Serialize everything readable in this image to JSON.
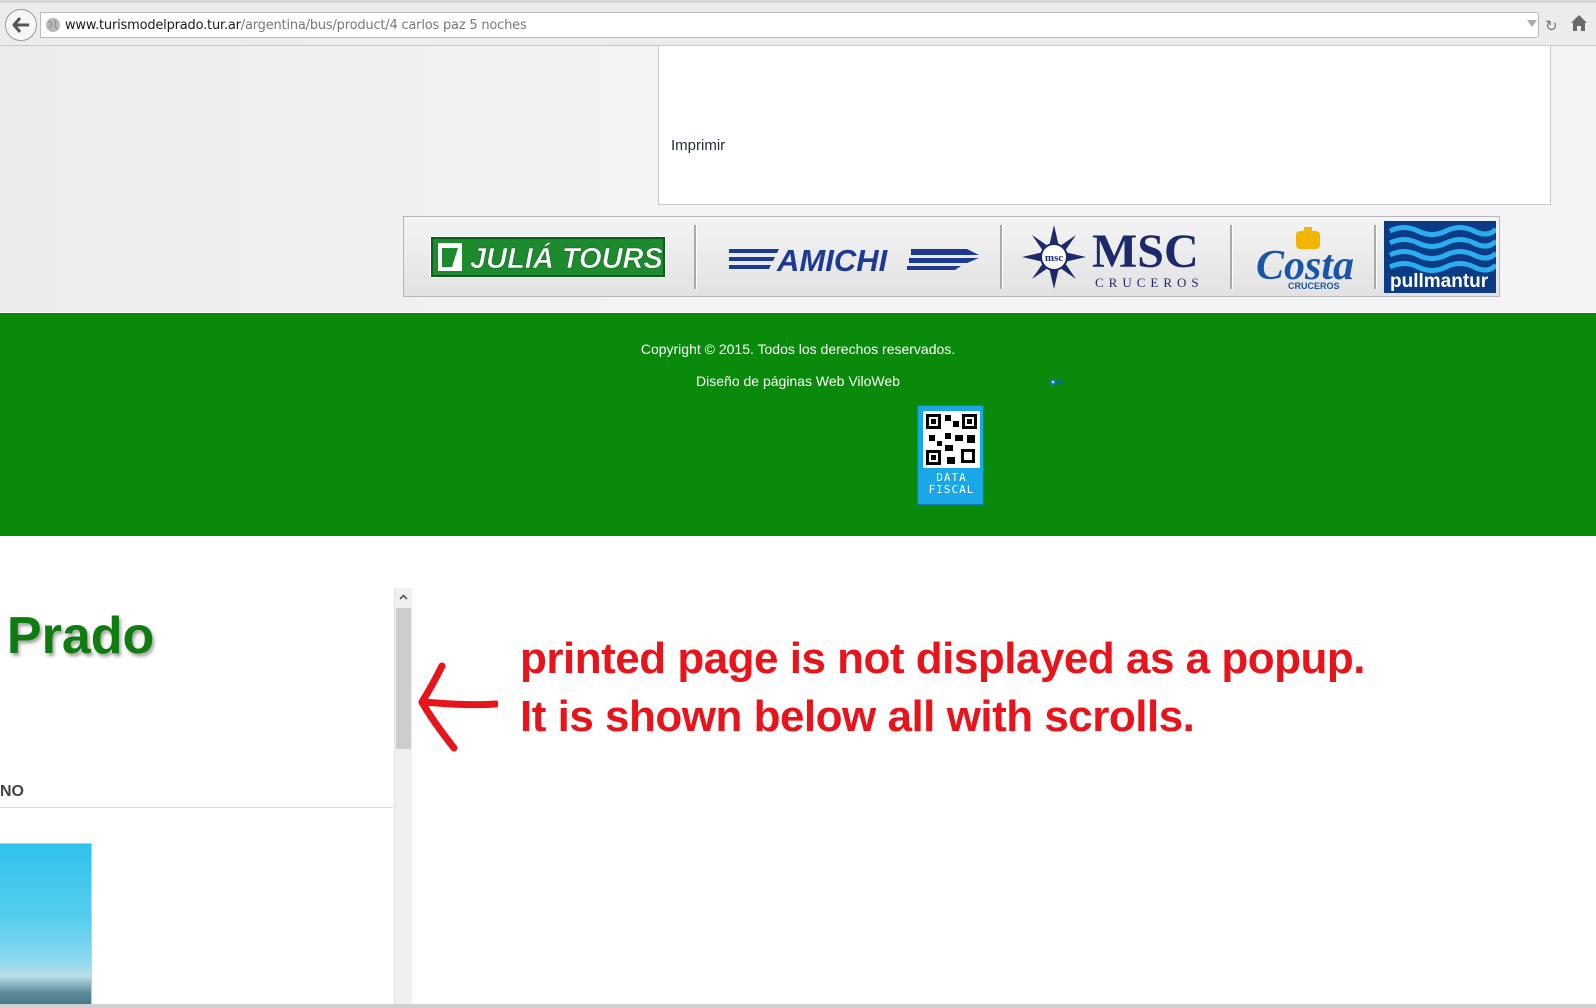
{
  "browser": {
    "url_domain": "www.turismodelprado.tur.ar",
    "url_path": "/argentina/bus/product/4 carlos paz 5 noches"
  },
  "print_box": {
    "print_label": "Imprimir"
  },
  "partners": [
    {
      "name": "JULIÁ TOURS",
      "icon": "julia-tours-logo"
    },
    {
      "name": "AMICHI",
      "icon": "amichi-logo"
    },
    {
      "name": "MSC",
      "sub": "CRUCEROS",
      "icon": "msc-cruceros-logo"
    },
    {
      "name": "Costa",
      "sub": "CRUCEROS",
      "icon": "costa-cruceros-logo"
    },
    {
      "name": "pullmantur",
      "icon": "pullmantur-logo"
    }
  ],
  "footer": {
    "copyright": "Copyright © 2015. Todos los derechos reservados.",
    "design_credit": "Diseño de páginas Web ViloWeb",
    "data_fiscal_line1": "DATA",
    "data_fiscal_line2": "FISCAL"
  },
  "print_frame": {
    "title_fragment": "l Prado",
    "subheading_fragment": "NO"
  },
  "annotation": {
    "line1": "printed page is not displayed as a popup.",
    "line2": "It is shown below all with scrolls."
  },
  "colors": {
    "footer_green": "#0a8a0a",
    "annotation_red": "#e8141b",
    "title_green": "#0f7c12"
  }
}
